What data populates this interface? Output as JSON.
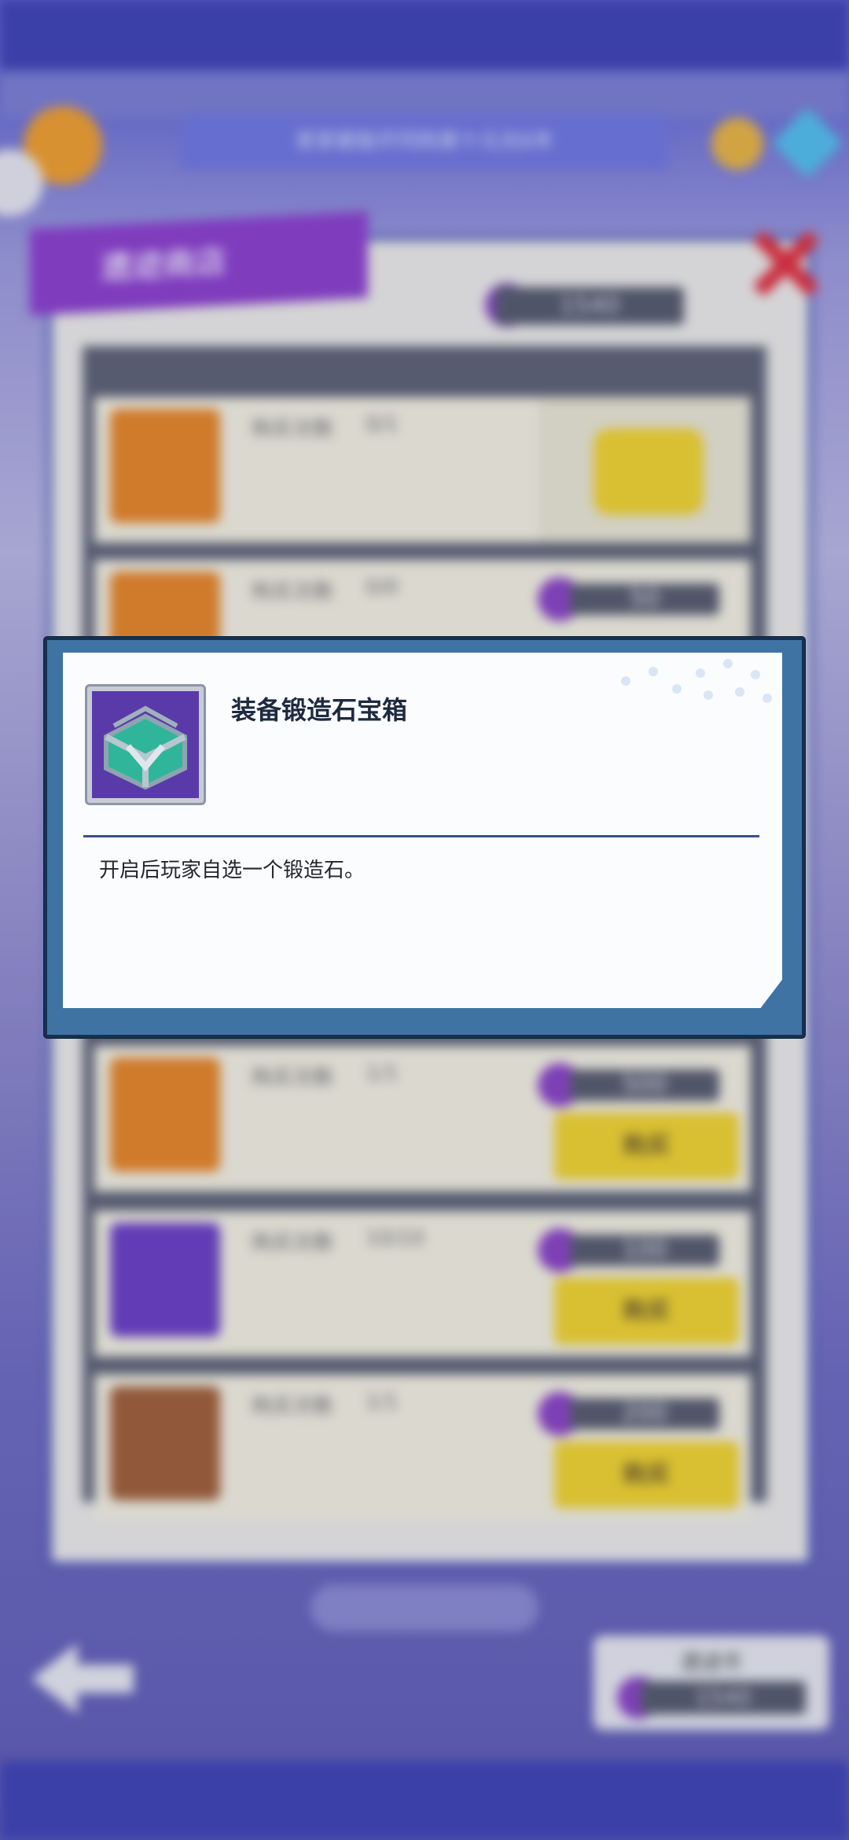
{
  "top": {
    "notice_text": "家家都能环同购第十元兑6年"
  },
  "shop": {
    "title": "遗迹商店",
    "currency_balance": "1540",
    "rows": [
      {
        "label": "购买次数",
        "count": "0/1",
        "status": "sold"
      },
      {
        "label": "购买次数",
        "count": "0/0",
        "price": "50"
      },
      {
        "label": "购买次数",
        "count": "1/1",
        "price": "500",
        "buy_label": "购买"
      },
      {
        "label": "购买次数",
        "count": "10/10",
        "price": "100",
        "buy_label": "购买"
      },
      {
        "label": "购买次数",
        "count": "1/1",
        "price": "200",
        "buy_label": "购买"
      }
    ]
  },
  "bottom": {
    "currency_title": "遗迹币",
    "currency_balance": "1540"
  },
  "popup": {
    "item_name": "装备锻造石宝箱",
    "description": "开启后玩家自选一个锻造石。",
    "icon": "treasure-chest-icon"
  },
  "colors": {
    "popup_border": "#3f73a3",
    "buy_button": "#f2d531",
    "shop_flag": "#8b3fd0",
    "close": "#e03040"
  }
}
